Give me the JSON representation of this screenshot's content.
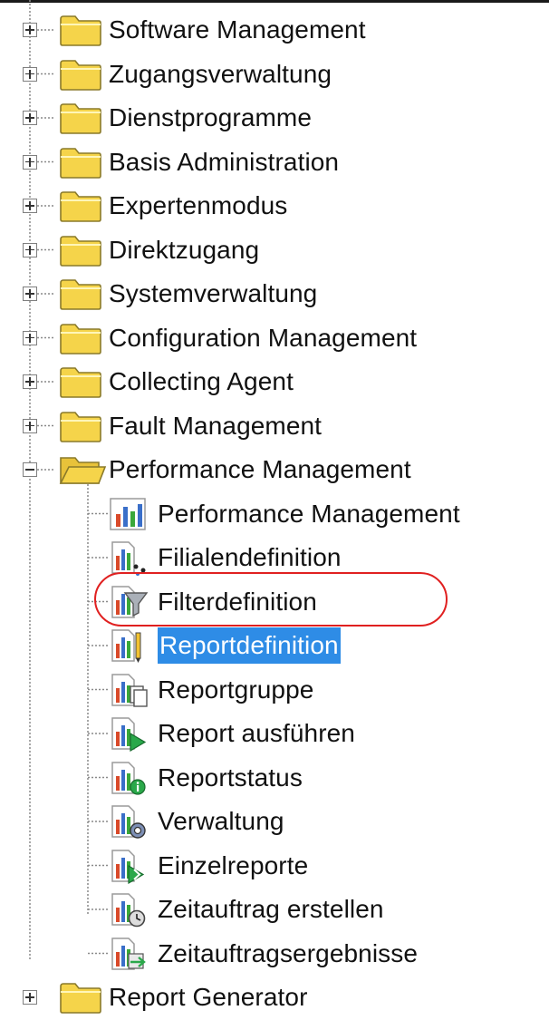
{
  "tree": {
    "nodes": [
      {
        "label": "Software Management",
        "kind": "folder",
        "expanded": false
      },
      {
        "label": "Zugangsverwaltung",
        "kind": "folder",
        "expanded": false
      },
      {
        "label": "Dienstprogramme",
        "kind": "folder",
        "expanded": false
      },
      {
        "label": "Basis Administration",
        "kind": "folder",
        "expanded": false
      },
      {
        "label": "Expertenmodus",
        "kind": "folder",
        "expanded": false
      },
      {
        "label": "Direktzugang",
        "kind": "folder",
        "expanded": false
      },
      {
        "label": "Systemverwaltung",
        "kind": "folder",
        "expanded": false
      },
      {
        "label": "Configuration Management",
        "kind": "folder",
        "expanded": false
      },
      {
        "label": "Collecting Agent",
        "kind": "folder",
        "expanded": false
      },
      {
        "label": "Fault Management",
        "kind": "folder",
        "expanded": false
      },
      {
        "label": "Performance Management",
        "kind": "folder",
        "expanded": true
      },
      {
        "label": "Performance Management",
        "kind": "item",
        "icon": "performance-chart-icon"
      },
      {
        "label": "Filialendefinition",
        "kind": "item",
        "icon": "branch-definition-icon"
      },
      {
        "label": "Filterdefinition",
        "kind": "item",
        "icon": "filter-definition-icon"
      },
      {
        "label": "Reportdefinition",
        "kind": "item",
        "icon": "report-definition-icon",
        "selected": true
      },
      {
        "label": "Reportgruppe",
        "kind": "item",
        "icon": "report-group-icon"
      },
      {
        "label": "Report ausführen",
        "kind": "item",
        "icon": "report-run-icon"
      },
      {
        "label": "Reportstatus",
        "kind": "item",
        "icon": "report-status-icon"
      },
      {
        "label": "Verwaltung",
        "kind": "item",
        "icon": "report-admin-icon"
      },
      {
        "label": "Einzelreporte",
        "kind": "item",
        "icon": "single-reports-icon"
      },
      {
        "label": "Zeitauftrag erstellen",
        "kind": "item",
        "icon": "schedule-create-icon"
      },
      {
        "label": "Zeitauftragsergebnisse",
        "kind": "item",
        "icon": "schedule-results-icon"
      },
      {
        "label": "Report Generator",
        "kind": "folder",
        "expanded": false
      }
    ]
  },
  "colors": {
    "selection": "#2e8ce6",
    "highlight_oval": "#e02020",
    "folder_fill": "#f5d44a",
    "folder_stroke": "#8a7a2a"
  }
}
